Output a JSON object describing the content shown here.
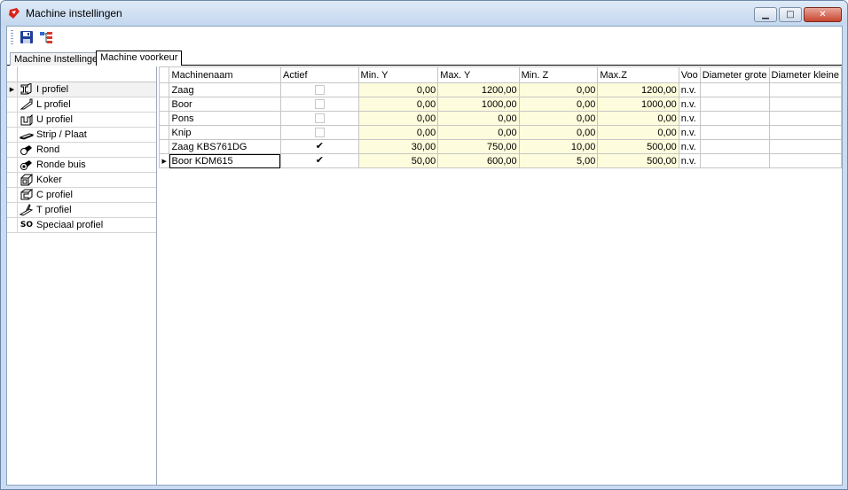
{
  "window": {
    "title": "Machine instellingen",
    "minimize": "▁",
    "maximize": "□",
    "close": "✕"
  },
  "toolbar": {
    "save": "save-icon",
    "tree": "tree-icon"
  },
  "tabs": [
    {
      "label": "Machine Instellingen",
      "active": false
    },
    {
      "label": "Machine voorkeur",
      "active": true
    }
  ],
  "profiles": [
    {
      "label": "I profiel",
      "icon": "i-profile-icon",
      "selected": true
    },
    {
      "label": "L profiel",
      "icon": "l-profile-icon"
    },
    {
      "label": "U profiel",
      "icon": "u-profile-icon"
    },
    {
      "label": "Strip / Plaat",
      "icon": "strip-plate-icon"
    },
    {
      "label": "Rond",
      "icon": "round-icon"
    },
    {
      "label": "Ronde buis",
      "icon": "round-tube-icon"
    },
    {
      "label": "Koker",
      "icon": "box-section-icon"
    },
    {
      "label": "C profiel",
      "icon": "c-profile-icon"
    },
    {
      "label": "T profiel",
      "icon": "t-profile-icon"
    },
    {
      "label": "Speciaal profiel",
      "icon": "special-profile-icon",
      "icon_text": "SO"
    }
  ],
  "grid": {
    "columns": [
      "Machinenaam",
      "Actief",
      "Min. Y",
      "Max. Y",
      "Min. Z",
      "Max.Z",
      "Voo",
      "Diameter grote",
      "Diameter kleine"
    ],
    "rows": [
      {
        "name": "Zaag",
        "actief": false,
        "min_y": "0,00",
        "max_y": "1200,00",
        "min_z": "0,00",
        "max_z": "1200,00",
        "voo": "n.v.",
        "dg": "",
        "dk": ""
      },
      {
        "name": "Boor",
        "actief": false,
        "min_y": "0,00",
        "max_y": "1000,00",
        "min_z": "0,00",
        "max_z": "1000,00",
        "voo": "n.v.",
        "dg": "",
        "dk": ""
      },
      {
        "name": "Pons",
        "actief": false,
        "min_y": "0,00",
        "max_y": "0,00",
        "min_z": "0,00",
        "max_z": "0,00",
        "voo": "n.v.",
        "dg": "",
        "dk": ""
      },
      {
        "name": "Knip",
        "actief": false,
        "min_y": "0,00",
        "max_y": "0,00",
        "min_z": "0,00",
        "max_z": "0,00",
        "voo": "n.v.",
        "dg": "",
        "dk": ""
      },
      {
        "name": "Zaag KBS761DG",
        "actief": true,
        "min_y": "30,00",
        "max_y": "750,00",
        "min_z": "10,00",
        "max_z": "500,00",
        "voo": "n.v.",
        "dg": "",
        "dk": ""
      },
      {
        "name": "Boor KDM615",
        "actief": true,
        "min_y": "50,00",
        "max_y": "600,00",
        "min_z": "5,00",
        "max_z": "500,00",
        "voo": "n.v.",
        "dg": "",
        "dk": "",
        "current": true
      }
    ]
  },
  "row_indicator": "▶"
}
